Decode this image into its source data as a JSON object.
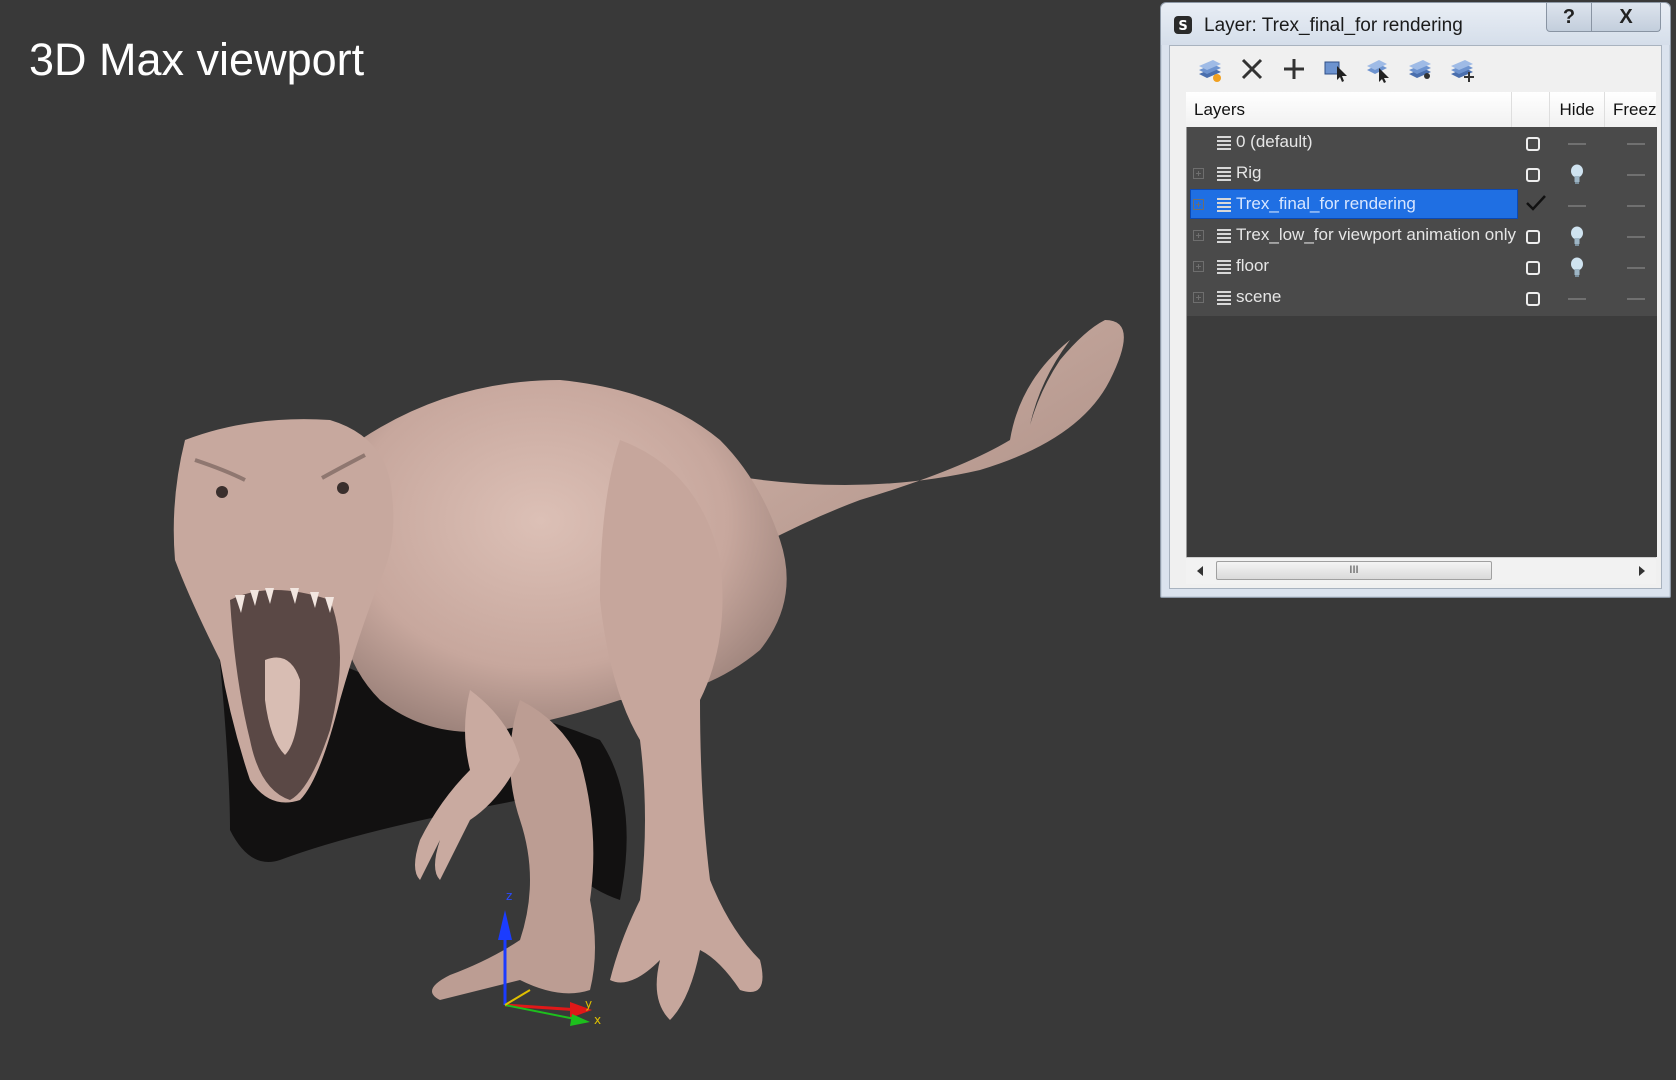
{
  "viewport": {
    "label": "3D Max viewport",
    "background": "#393939",
    "axis_labels": {
      "z": "z",
      "y": "y",
      "x": "x"
    }
  },
  "dialog": {
    "title": "Layer: Trex_final_for rendering",
    "help_button": "?",
    "close_button": "X",
    "toolbar": [
      {
        "name": "create-new-layer-icon"
      },
      {
        "name": "delete-layer-icon"
      },
      {
        "name": "add-selected-to-layer-icon"
      },
      {
        "name": "select-objects-in-layer-icon"
      },
      {
        "name": "highlight-selected-layer-icon"
      },
      {
        "name": "hide-unhide-all-icon"
      },
      {
        "name": "freeze-unfreeze-all-icon"
      }
    ],
    "columns": {
      "layers": "Layers",
      "current": "",
      "hide": "Hide",
      "freeze": "Freeze"
    },
    "rows": [
      {
        "label": "0 (default)",
        "expandable": false,
        "selected": false,
        "current": false,
        "hidden": false,
        "frozen": false
      },
      {
        "label": "Rig",
        "expandable": true,
        "selected": false,
        "current": false,
        "hidden": true,
        "frozen": false
      },
      {
        "label": "Trex_final_for rendering",
        "expandable": true,
        "selected": true,
        "current": true,
        "hidden": false,
        "frozen": false
      },
      {
        "label": "Trex_low_for viewport animation only",
        "expandable": true,
        "selected": false,
        "current": false,
        "hidden": true,
        "frozen": false
      },
      {
        "label": "floor",
        "expandable": true,
        "selected": false,
        "current": false,
        "hidden": true,
        "frozen": false
      },
      {
        "label": "scene",
        "expandable": true,
        "selected": false,
        "current": false,
        "hidden": false,
        "frozen": false
      }
    ],
    "scrollbar": {
      "thumb_grip": "III"
    },
    "colors": {
      "selection": "#1f6fe3",
      "list_bg": "#4a4a4a",
      "model_skin": "#c9aaa0"
    }
  }
}
